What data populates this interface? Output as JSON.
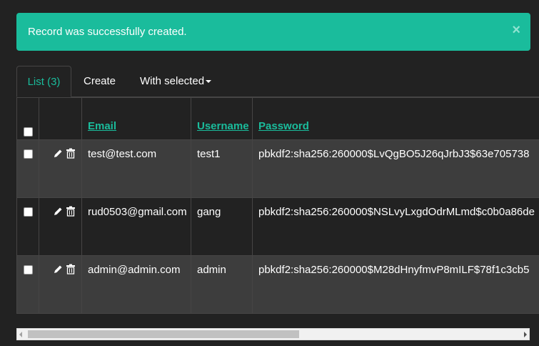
{
  "alert": {
    "message": "Record was successfully created.",
    "close_label": "×",
    "color": "#1abc9c"
  },
  "tabs": [
    {
      "label": "List (3)",
      "active": true
    },
    {
      "label": "Create",
      "active": false
    },
    {
      "label": "With selected",
      "active": false,
      "dropdown": true
    }
  ],
  "table": {
    "columns": [
      {
        "key": "email",
        "label": "Email"
      },
      {
        "key": "username",
        "label": "Username"
      },
      {
        "key": "password",
        "label": "Password"
      }
    ],
    "rows": [
      {
        "email": "test@test.com",
        "username": "test1",
        "password": "pbkdf2:sha256:260000$LvQgBO5J26qJrbJ3$63e705738"
      },
      {
        "email": "rud0503@gmail.com",
        "username": "gang",
        "password": "pbkdf2:sha256:260000$NSLvyLxgdOdrMLmd$c0b0a86de"
      },
      {
        "email": "admin@admin.com",
        "username": "admin",
        "password": "pbkdf2:sha256:260000$M28dHnyfmvP8mILF$78f1c3cb5"
      }
    ],
    "row_icons": [
      "pencil-icon",
      "trash-icon"
    ]
  },
  "theme": {
    "accent": "#1abc9c",
    "background": "#222222",
    "row_alt": "#3d3d3d",
    "border": "#464545"
  }
}
